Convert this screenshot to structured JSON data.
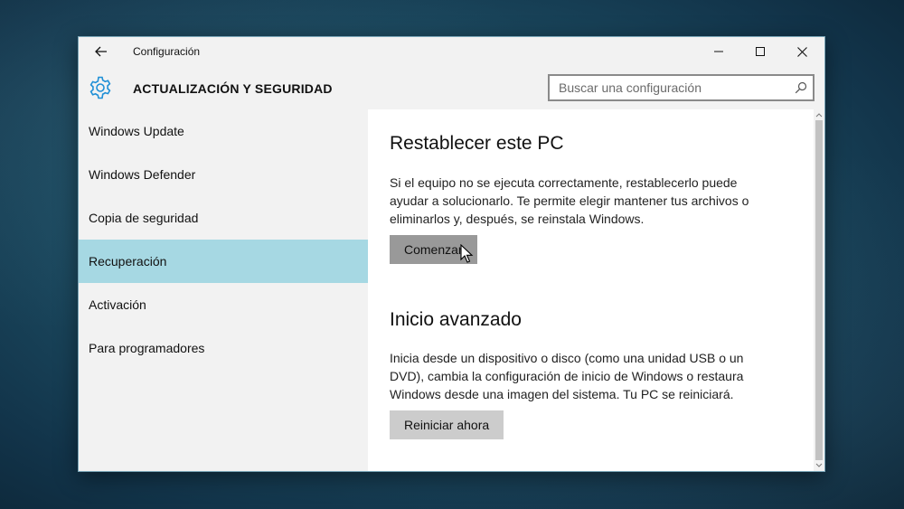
{
  "window": {
    "title": "Configuración",
    "controls": [
      "minimize",
      "maximize",
      "close"
    ]
  },
  "header": {
    "title": "ACTUALIZACIÓN Y SEGURIDAD",
    "icon": "gear-icon"
  },
  "search": {
    "placeholder": "Buscar una configuración",
    "value": ""
  },
  "sidebar": {
    "items": [
      {
        "label": "Windows Update"
      },
      {
        "label": "Windows Defender"
      },
      {
        "label": "Copia de seguridad"
      },
      {
        "label": "Recuperación",
        "selected": true
      },
      {
        "label": "Activación"
      },
      {
        "label": "Para programadores"
      }
    ]
  },
  "main": {
    "reset": {
      "title": "Restablecer este PC",
      "description": "Si el equipo no se ejecuta correctamente, restablecerlo puede ayudar a solucionarlo. Te permite elegir mantener tus archivos o eliminarlos y, después, se reinstala Windows.",
      "button_label": "Comenzar"
    },
    "advanced": {
      "title": "Inicio avanzado",
      "description": "Inicia desde un dispositivo o disco (como una unidad USB o un DVD), cambia la configuración de inicio de Windows o restaura Windows desde una imagen del sistema. Tu PC se reiniciará.",
      "button_label": "Reiniciar ahora"
    }
  },
  "colors": {
    "selected_nav": "#a6d8e3",
    "gear_accent": "#1e8fd6",
    "button": "#cccccc",
    "button_pressed": "#999999"
  }
}
